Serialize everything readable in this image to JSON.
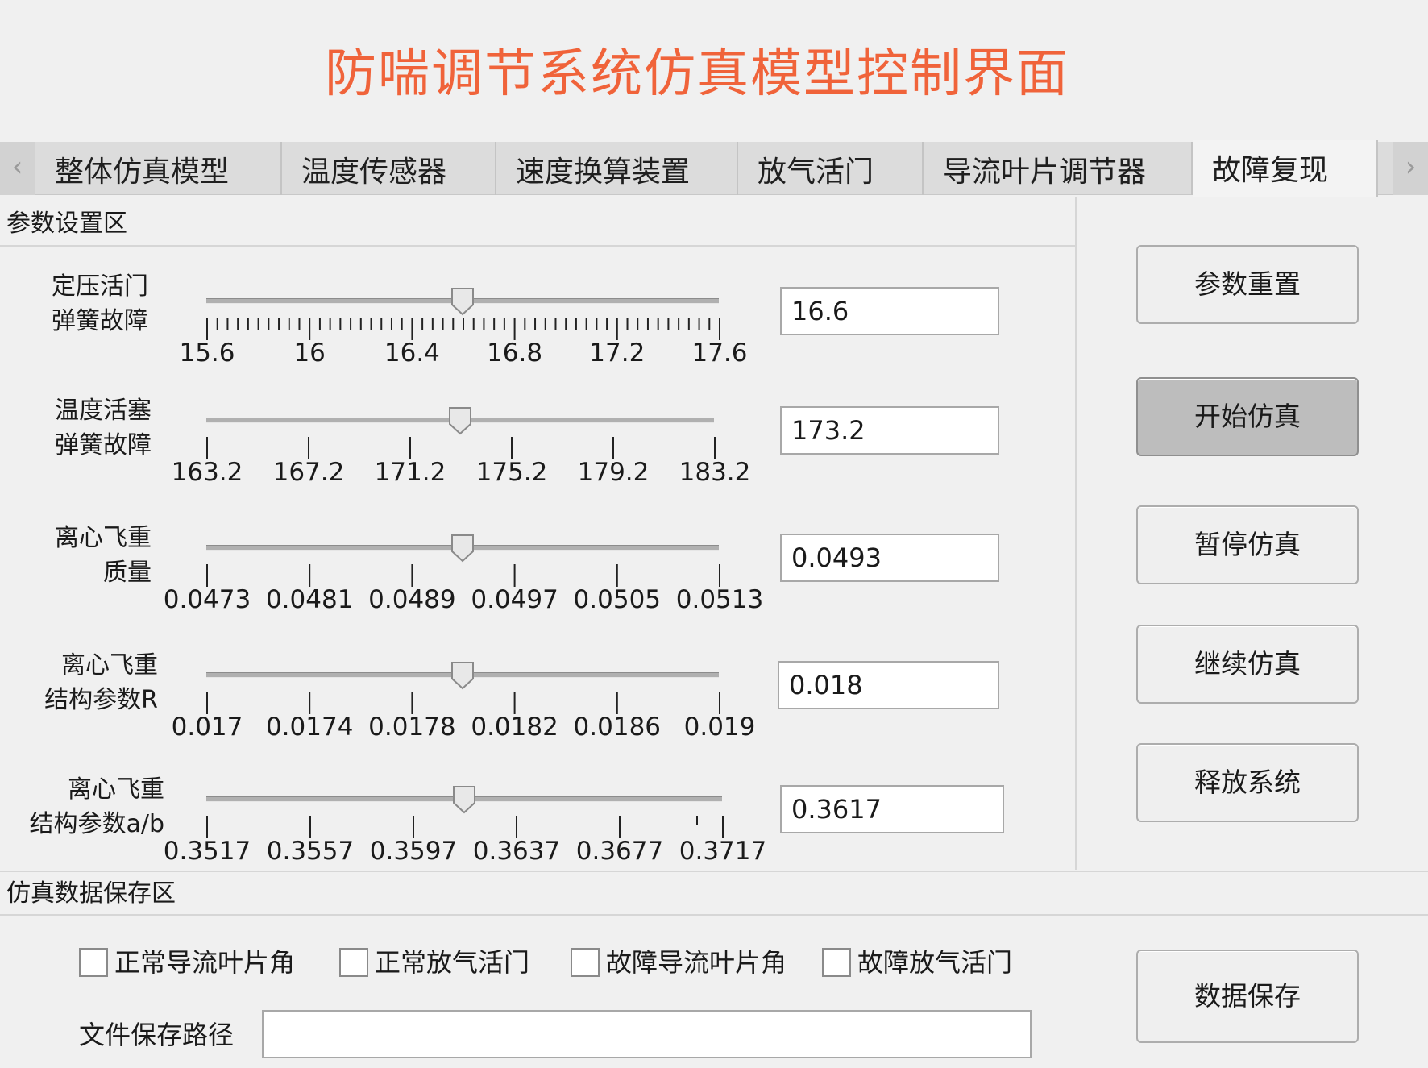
{
  "title": "防喘调节系统仿真模型控制界面",
  "tabs": [
    {
      "label": "整体仿真模型",
      "active": false
    },
    {
      "label": "温度传感器",
      "active": false
    },
    {
      "label": "速度换算装置",
      "active": false
    },
    {
      "label": "放气活门",
      "active": false
    },
    {
      "label": "导流叶片调节器",
      "active": false
    },
    {
      "label": "故障复现",
      "active": true
    }
  ],
  "tab_scroll": {
    "left_icon": "chevron-left-icon",
    "right_icon": "chevron-right-icon"
  },
  "params_panel": {
    "heading": "参数设置区"
  },
  "sliders": [
    {
      "label": "定压活门\n弹簧故障",
      "ticks": [
        "15.6",
        "16",
        "16.4",
        "16.8",
        "17.2",
        "17.6"
      ],
      "min": 15.6,
      "max": 17.6,
      "minor_ticks_per_interval": 10,
      "value": 16.6,
      "value_text": "16.6"
    },
    {
      "label": "温度活塞\n弹簧故障",
      "ticks": [
        "163.2",
        "167.2",
        "171.2",
        "175.2",
        "179.2",
        "183.2"
      ],
      "min": 163.2,
      "max": 183.2,
      "minor_ticks_per_interval": 0,
      "value": 173.2,
      "value_text": "173.2"
    },
    {
      "label": "离心飞重\n质量",
      "ticks": [
        "0.0473",
        "0.0481",
        "0.0489",
        "0.0497",
        "0.0505",
        "0.0513"
      ],
      "min": 0.0473,
      "max": 0.0513,
      "minor_ticks_per_interval": 0,
      "value": 0.0493,
      "value_text": "0.0493"
    },
    {
      "label": "离心飞重\n结构参数R",
      "ticks": [
        "0.017",
        "0.0174",
        "0.0178",
        "0.0182",
        "0.0186",
        "0.019"
      ],
      "min": 0.017,
      "max": 0.019,
      "minor_ticks_per_interval": 0,
      "value": 0.018,
      "value_text": "0.018"
    },
    {
      "label": "离心飞重\n结构参数a/b",
      "ticks": [
        "0.3517",
        "0.3557",
        "0.3597",
        "0.3637",
        "0.3677",
        "0.3717"
      ],
      "min": 0.3517,
      "max": 0.3717,
      "minor_ticks_per_interval": 0,
      "value": 0.3617,
      "value_text": "0.3617"
    }
  ],
  "buttons": {
    "reset": "参数重置",
    "start": "开始仿真",
    "pause": "暂停仿真",
    "resume": "继续仿真",
    "release": "释放系统",
    "save": "数据保存"
  },
  "save_panel": {
    "heading": "仿真数据保存区",
    "checkboxes": [
      {
        "label": "正常导流叶片角",
        "checked": false
      },
      {
        "label": "正常放气活门",
        "checked": false
      },
      {
        "label": "故障导流叶片角",
        "checked": false
      },
      {
        "label": "故障放气活门",
        "checked": false
      }
    ],
    "path_label": "文件保存路径",
    "path_value": ""
  },
  "colors": {
    "title": "#f0633a",
    "pressed_button": "#bdbdbd"
  }
}
